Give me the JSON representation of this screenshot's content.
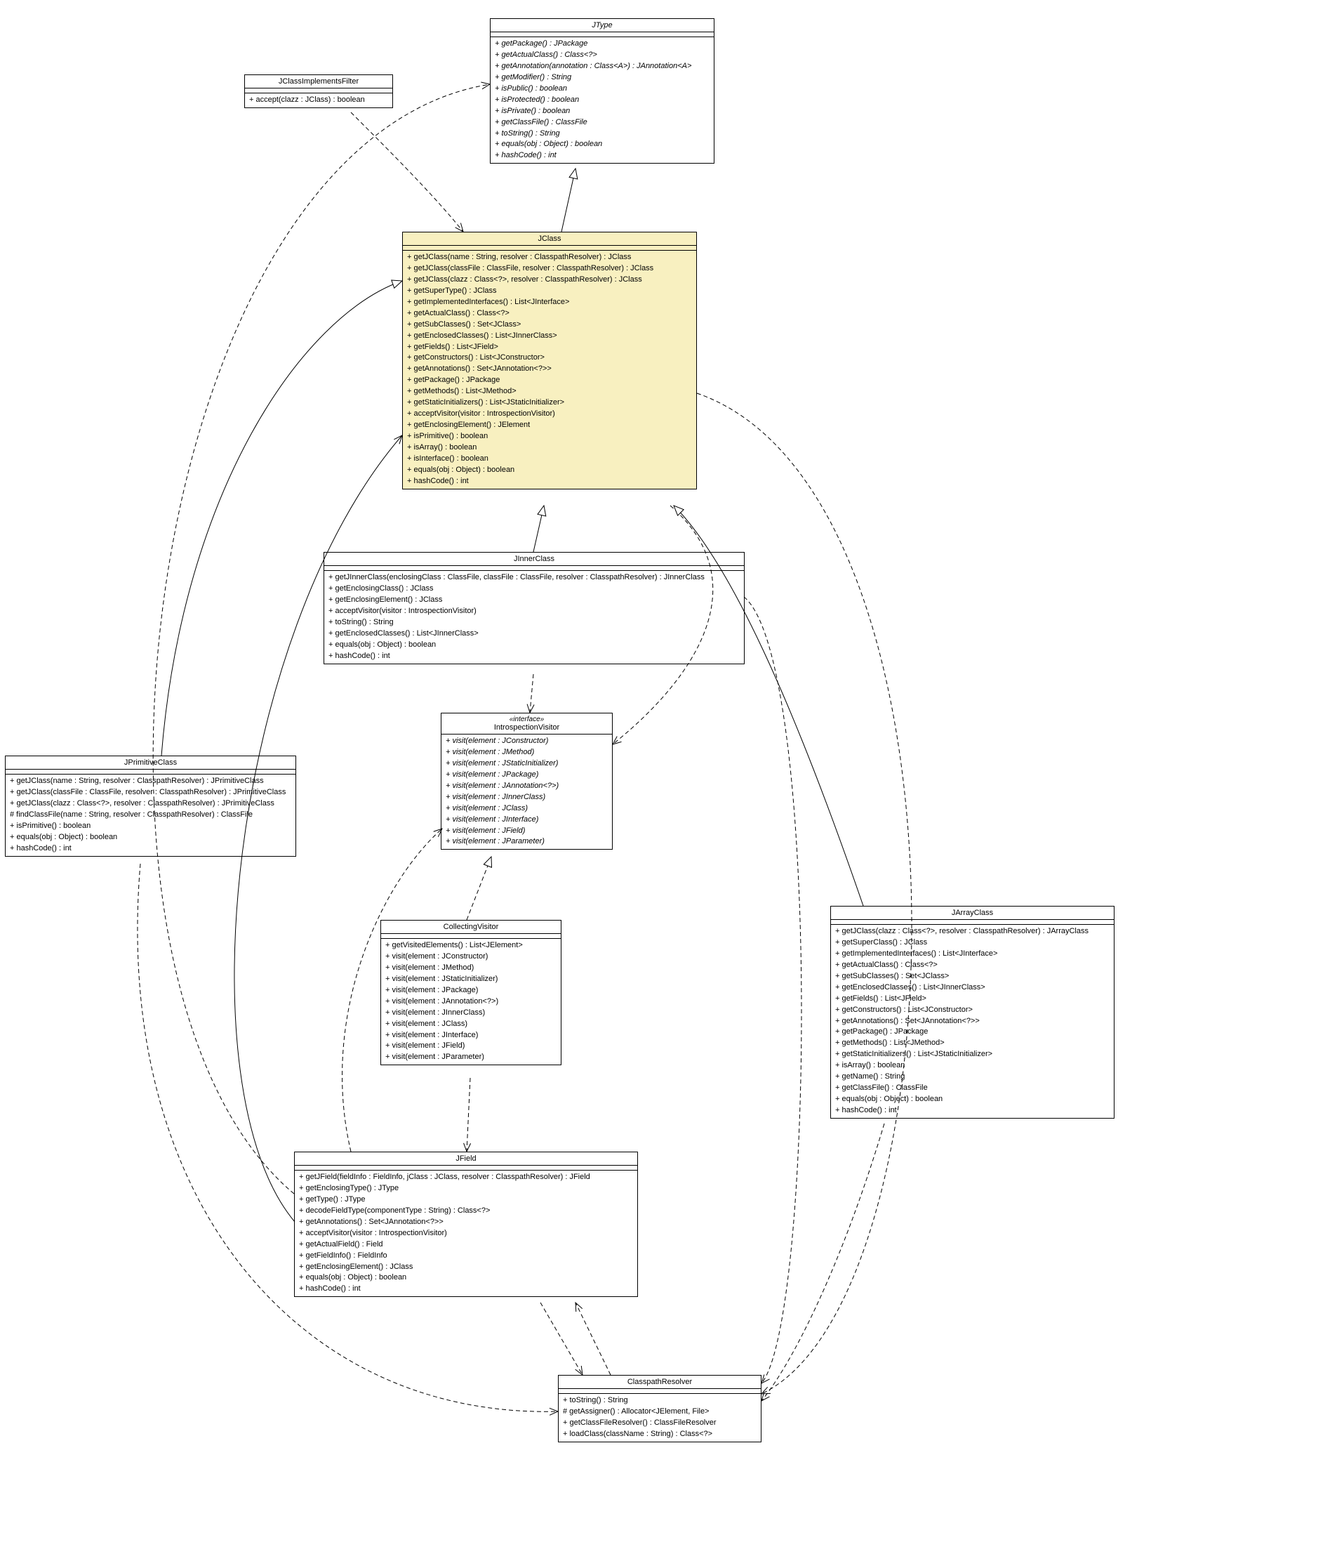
{
  "JType": {
    "name": "JType",
    "ops": [
      "+ getPackage() : JPackage",
      "+ getActualClass() : Class<?>",
      "+ getAnnotation(annotation : Class<A>) : JAnnotation<A>",
      "+ getModifier() : String",
      "+ isPublic() : boolean",
      "+ isProtected() : boolean",
      "+ isPrivate() : boolean",
      "+ getClassFile() : ClassFile",
      "+ toString() : String",
      "+ equals(obj : Object) : boolean",
      "+ hashCode() : int"
    ]
  },
  "JClassImplementsFilter": {
    "name": "JClassImplementsFilter",
    "ops": [
      "+ accept(clazz : JClass) : boolean"
    ]
  },
  "JClass": {
    "name": "JClass",
    "ops": [
      "+ getJClass(name : String, resolver : ClasspathResolver) : JClass",
      "+ getJClass(classFile : ClassFile, resolver : ClasspathResolver) : JClass",
      "+ getJClass(clazz : Class<?>, resolver : ClasspathResolver) : JClass",
      "+ getSuperType() : JClass",
      "+ getImplementedInterfaces() : List<JInterface>",
      "+ getActualClass() : Class<?>",
      "+ getSubClasses() : Set<JClass>",
      "+ getEnclosedClasses() : List<JInnerClass>",
      "+ getFields() : List<JField>",
      "+ getConstructors() : List<JConstructor>",
      "+ getAnnotations() : Set<JAnnotation<?>>",
      "+ getPackage() : JPackage",
      "+ getMethods() : List<JMethod>",
      "+ getStaticInitializers() : List<JStaticInitializer>",
      "+ acceptVisitor(visitor : IntrospectionVisitor)",
      "+ getEnclosingElement() : JElement",
      "+ isPrimitive() : boolean",
      "+ isArray() : boolean",
      "+ isInterface() : boolean",
      "+ equals(obj : Object) : boolean",
      "+ hashCode() : int"
    ]
  },
  "JInnerClass": {
    "name": "JInnerClass",
    "ops": [
      "+ getJInnerClass(enclosingClass : ClassFile, classFile : ClassFile, resolver : ClasspathResolver) : JInnerClass",
      "+ getEnclosingClass() : JClass",
      "+ getEnclosingElement() : JClass",
      "+ acceptVisitor(visitor : IntrospectionVisitor)",
      "+ toString() : String",
      "+ getEnclosedClasses() : List<JInnerClass>",
      "+ equals(obj : Object) : boolean",
      "+ hashCode() : int"
    ]
  },
  "IntrospectionVisitor": {
    "stereo": "«interface»",
    "name": "IntrospectionVisitor",
    "ops": [
      "+ visit(element : JConstructor)",
      "+ visit(element : JMethod)",
      "+ visit(element : JStaticInitializer)",
      "+ visit(element : JPackage)",
      "+ visit(element : JAnnotation<?>)",
      "+ visit(element : JInnerClass)",
      "+ visit(element : JClass)",
      "+ visit(element : JInterface)",
      "+ visit(element : JField)",
      "+ visit(element : JParameter)"
    ]
  },
  "JPrimitiveClass": {
    "name": "JPrimitiveClass",
    "ops": [
      "+ getJClass(name : String, resolver : ClasspathResolver) : JPrimitiveClass",
      "+ getJClass(classFile : ClassFile, resolver : ClasspathResolver) : JPrimitiveClass",
      "+ getJClass(clazz : Class<?>, resolver : ClasspathResolver) : JPrimitiveClass",
      "# findClassFile(name : String, resolver : ClasspathResolver) : ClassFile",
      "+ isPrimitive() : boolean",
      "+ equals(obj : Object) : boolean",
      "+ hashCode() : int"
    ]
  },
  "CollectingVisitor": {
    "name": "CollectingVisitor",
    "ops": [
      "+ getVisitedElements() : List<JElement>",
      "+ visit(element : JConstructor)",
      "+ visit(element : JMethod)",
      "+ visit(element : JStaticInitializer)",
      "+ visit(element : JPackage)",
      "+ visit(element : JAnnotation<?>)",
      "+ visit(element : JInnerClass)",
      "+ visit(element : JClass)",
      "+ visit(element : JInterface)",
      "+ visit(element : JField)",
      "+ visit(element : JParameter)"
    ]
  },
  "JArrayClass": {
    "name": "JArrayClass",
    "ops": [
      "+ getJClass(clazz : Class<?>, resolver : ClasspathResolver) : JArrayClass",
      "+ getSuperClass() : JClass",
      "+ getImplementedInterfaces() : List<JInterface>",
      "+ getActualClass() : Class<?>",
      "+ getSubClasses() : Set<JClass>",
      "+ getEnclosedClasses() : List<JInnerClass>",
      "+ getFields() : List<JField>",
      "+ getConstructors() : List<JConstructor>",
      "+ getAnnotations() : Set<JAnnotation<?>>",
      "+ getPackage() : JPackage",
      "+ getMethods() : List<JMethod>",
      "+ getStaticInitializers() : List<JStaticInitializer>",
      "+ isArray() : boolean",
      "+ getName() : String",
      "+ getClassFile() : ClassFile",
      "+ equals(obj : Object) : boolean",
      "+ hashCode() : int"
    ]
  },
  "JField": {
    "name": "JField",
    "ops": [
      "+ getJField(fieldInfo : FieldInfo, jClass : JClass, resolver : ClasspathResolver) : JField",
      "+ getEnclosingType() : JType",
      "+ getType() : JType",
      "+ decodeFieldType(componentType : String) : Class<?>",
      "+ getAnnotations() : Set<JAnnotation<?>>",
      "+ acceptVisitor(visitor : IntrospectionVisitor)",
      "+ getActualField() : Field",
      "+ getFieldInfo() : FieldInfo",
      "+ getEnclosingElement() : JClass",
      "+ equals(obj : Object) : boolean",
      "+ hashCode() : int"
    ]
  },
  "ClasspathResolver": {
    "name": "ClasspathResolver",
    "ops": [
      "+ toString() : String",
      "# getAssigner() : Allocator<JElement, File>",
      "+ getClassFileResolver() : ClassFileResolver",
      "+ loadClass(className : String) : Class<?>"
    ]
  }
}
